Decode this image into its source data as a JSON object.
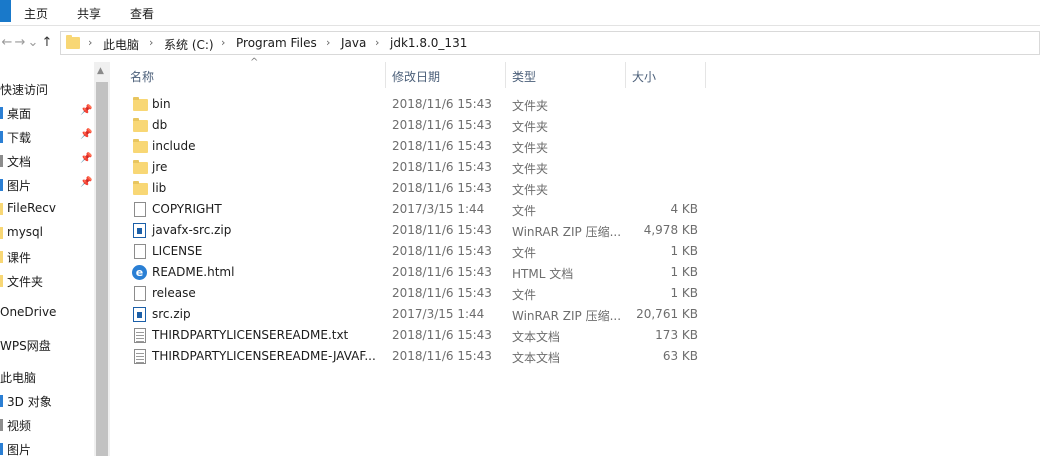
{
  "ribbon": {
    "tabs": [
      "主页",
      "共享",
      "查看"
    ]
  },
  "address": {
    "back_icon": "←",
    "forward_icon": "→",
    "recent_icon": "⌄",
    "up_icon": "↑",
    "separator": "›",
    "crumbs": [
      "此电脑",
      "系统 (C:)",
      "Program Files",
      "Java",
      "jdk1.8.0_131"
    ]
  },
  "nav": {
    "pin_icon": "📌",
    "items": [
      {
        "label": "快速访问"
      },
      {
        "label": "桌面"
      },
      {
        "label": "下载"
      },
      {
        "label": "文档"
      },
      {
        "label": "图片"
      },
      {
        "label": "FileRecv"
      },
      {
        "label": "mysql"
      },
      {
        "label": "课件"
      },
      {
        "label": "文件夹"
      },
      {
        "label": "OneDrive"
      },
      {
        "label": "WPS网盘"
      },
      {
        "label": "此电脑"
      },
      {
        "label": "3D 对象"
      },
      {
        "label": "视频"
      },
      {
        "label": "图片"
      }
    ]
  },
  "columns": {
    "name": "名称",
    "date": "修改日期",
    "type": "类型",
    "size": "大小",
    "sort_icon": "^"
  },
  "files": [
    {
      "name": "bin",
      "date": "2018/11/6 15:43",
      "type": "文件夹",
      "size": "",
      "icon": "folder"
    },
    {
      "name": "db",
      "date": "2018/11/6 15:43",
      "type": "文件夹",
      "size": "",
      "icon": "folder"
    },
    {
      "name": "include",
      "date": "2018/11/6 15:43",
      "type": "文件夹",
      "size": "",
      "icon": "folder"
    },
    {
      "name": "jre",
      "date": "2018/11/6 15:43",
      "type": "文件夹",
      "size": "",
      "icon": "folder"
    },
    {
      "name": "lib",
      "date": "2018/11/6 15:43",
      "type": "文件夹",
      "size": "",
      "icon": "folder"
    },
    {
      "name": "COPYRIGHT",
      "date": "2017/3/15 1:44",
      "type": "文件",
      "size": "4 KB",
      "icon": "file"
    },
    {
      "name": "javafx-src.zip",
      "date": "2018/11/6 15:43",
      "type": "WinRAR ZIP 压缩...",
      "size": "4,978 KB",
      "icon": "zip"
    },
    {
      "name": "LICENSE",
      "date": "2018/11/6 15:43",
      "type": "文件",
      "size": "1 KB",
      "icon": "file"
    },
    {
      "name": "README.html",
      "date": "2018/11/6 15:43",
      "type": "HTML 文档",
      "size": "1 KB",
      "icon": "html"
    },
    {
      "name": "release",
      "date": "2018/11/6 15:43",
      "type": "文件",
      "size": "1 KB",
      "icon": "file"
    },
    {
      "name": "src.zip",
      "date": "2017/3/15 1:44",
      "type": "WinRAR ZIP 压缩...",
      "size": "20,761 KB",
      "icon": "zip"
    },
    {
      "name": "THIRDPARTYLICENSEREADME.txt",
      "date": "2018/11/6 15:43",
      "type": "文本文档",
      "size": "173 KB",
      "icon": "txt"
    },
    {
      "name": "THIRDPARTYLICENSEREADME-JAVAF...",
      "date": "2018/11/6 15:43",
      "type": "文本文档",
      "size": "63 KB",
      "icon": "txt"
    }
  ]
}
